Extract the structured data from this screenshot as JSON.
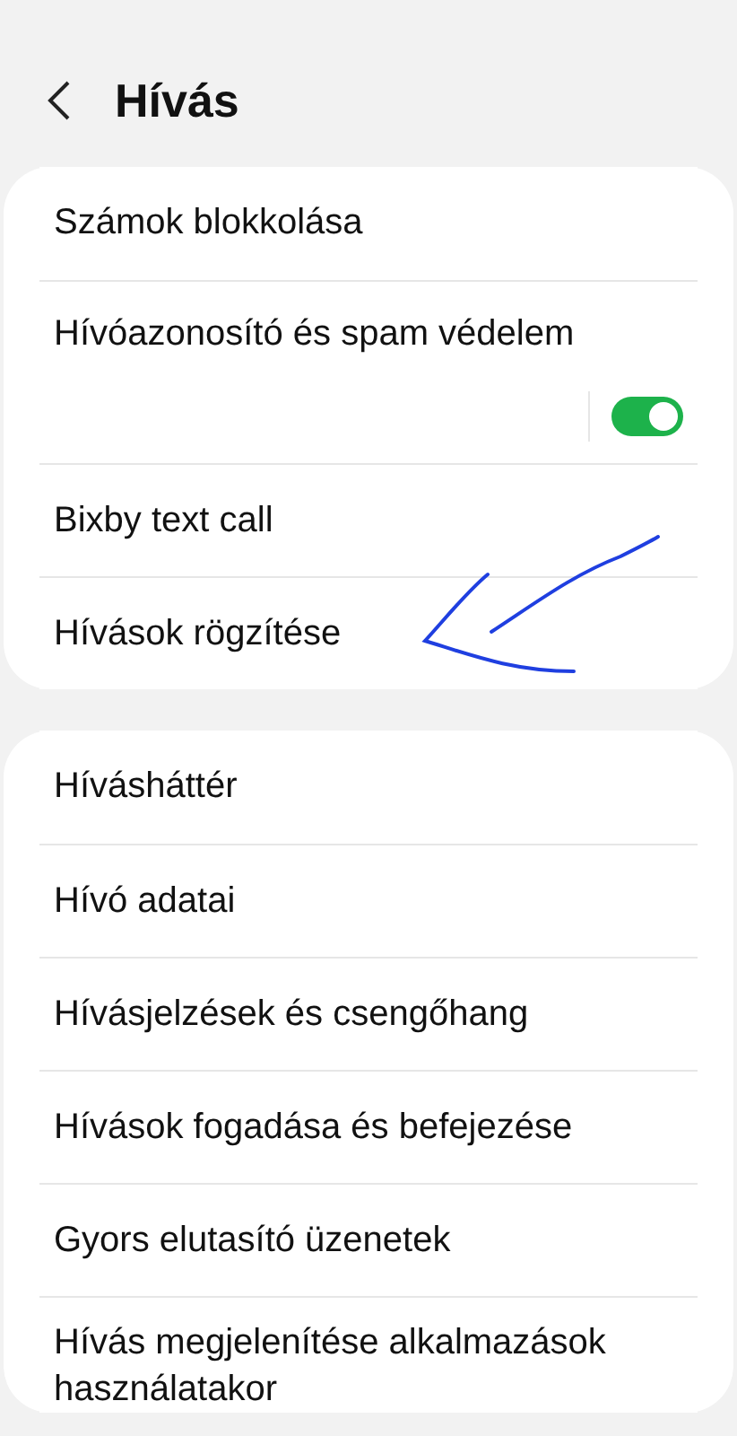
{
  "header": {
    "title": "Hívás"
  },
  "sections": [
    {
      "items": [
        {
          "kind": "link",
          "label": "Számok blokkolása"
        },
        {
          "kind": "toggle",
          "label": "Hívóazonosító és spam védelem",
          "on": true
        },
        {
          "kind": "link",
          "label": "Bixby text call"
        },
        {
          "kind": "link",
          "label": "Hívások rögzítése"
        }
      ]
    },
    {
      "items": [
        {
          "kind": "link",
          "label": "Hívásháttér"
        },
        {
          "kind": "link",
          "label": "Hívó adatai"
        },
        {
          "kind": "link",
          "label": "Hívásjelzések és csengőhang"
        },
        {
          "kind": "link",
          "label": "Hívások fogadása és befejezése"
        },
        {
          "kind": "link",
          "label": "Gyors elutasító üzenetek"
        },
        {
          "kind": "link",
          "label": "Hívás megjelenítése alkalmazások használatakor"
        }
      ]
    }
  ]
}
